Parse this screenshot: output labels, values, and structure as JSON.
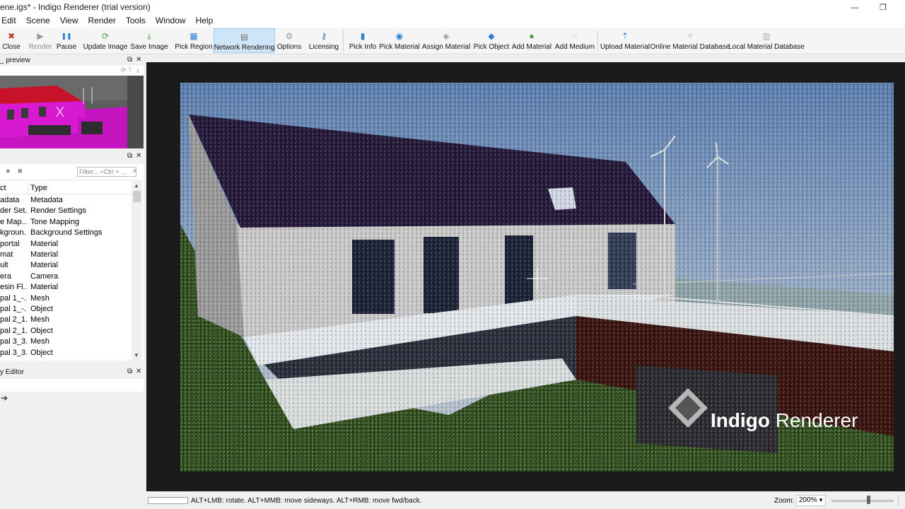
{
  "window": {
    "title": "ene.igs* - Indigo Renderer (trial version)"
  },
  "menu": [
    "Edit",
    "Scene",
    "View",
    "Render",
    "Tools",
    "Window",
    "Help"
  ],
  "toolbar": {
    "buttons": [
      {
        "label": "Close",
        "icon": "close-icon",
        "color": "#d0312d"
      },
      {
        "label": "Render",
        "icon": "play-icon",
        "color": "#9a9a9a"
      },
      {
        "label": "Pause",
        "icon": "pause-icon",
        "color": "#2b7fd6"
      },
      {
        "label": "Update Image",
        "icon": "refresh-icon",
        "color": "#3ba035"
      },
      {
        "label": "Save Image",
        "icon": "download-icon",
        "color": "#3ba035"
      },
      {
        "label": "Pick Region",
        "icon": "region-icon",
        "color": "#2b7fd6"
      },
      {
        "label": "Network Rendering",
        "icon": "network-icon",
        "color": "#777777"
      },
      {
        "label": "Options",
        "icon": "gear-icon",
        "color": "#999999"
      },
      {
        "label": "Licensing",
        "icon": "key-icon",
        "color": "#2b7fd6"
      },
      {
        "label": "Pick Info",
        "icon": "chart-icon",
        "color": "#2b7fd6"
      },
      {
        "label": "Pick Material",
        "icon": "pick-material-icon",
        "color": "#2b7fd6"
      },
      {
        "label": "Assign Material",
        "icon": "assign-material-icon",
        "color": "#9a9a9a"
      },
      {
        "label": "Pick Object",
        "icon": "pick-object-icon",
        "color": "#2b7fd6"
      },
      {
        "label": "Add Material",
        "icon": "add-material-icon",
        "color": "#3ba035"
      },
      {
        "label": "Add Medium",
        "icon": "add-medium-icon",
        "color": "#b0b0b0"
      },
      {
        "label": "Upload Material",
        "icon": "upload-icon",
        "color": "#2b7fd6"
      },
      {
        "label": "Online Material Database",
        "icon": "grid-icon",
        "color": "#3ba035"
      },
      {
        "label": "Local Material Database",
        "icon": "database-icon",
        "color": "#b0b0b0"
      }
    ]
  },
  "preview_panel": {
    "title": "_ preview"
  },
  "scene_panel": {
    "filter_placeholder": "Filter... <Ctrl + ...",
    "columns": [
      "ct",
      "Type"
    ],
    "rows": [
      {
        "name": "adata",
        "type": "Metadata"
      },
      {
        "name": "der Set...",
        "type": "Render Settings"
      },
      {
        "name": "e Map...",
        "type": "Tone Mapping"
      },
      {
        "name": "kgroun...",
        "type": "Background Settings"
      },
      {
        "name": "portal",
        "type": "Material"
      },
      {
        "name": "mat",
        "type": "Material"
      },
      {
        "name": "ult",
        "type": "Material"
      },
      {
        "name": "era",
        "type": "Camera"
      },
      {
        "name": "esin Fl...",
        "type": "Material"
      },
      {
        "name": "pal 1_-...",
        "type": "Mesh"
      },
      {
        "name": "pal 1_-...",
        "type": "Object"
      },
      {
        "name": "pal 2_1...",
        "type": "Mesh"
      },
      {
        "name": "pal 2_1...",
        "type": "Object"
      },
      {
        "name": "pal 3_3...",
        "type": "Mesh"
      },
      {
        "name": "pal 3_3...",
        "type": "Object"
      }
    ]
  },
  "property_panel": {
    "title": "y Editor"
  },
  "render_view": {
    "watermark_bold": "Indigo",
    "watermark_light": "Renderer"
  },
  "status": {
    "hint": "ALT+LMB: rotate. ALT+MMB: move sideways. ALT+RMB: move fwd/back.",
    "zoom_label": "Zoom:",
    "zoom_value": "200%",
    "zoom_slider_fraction": 0.6
  }
}
